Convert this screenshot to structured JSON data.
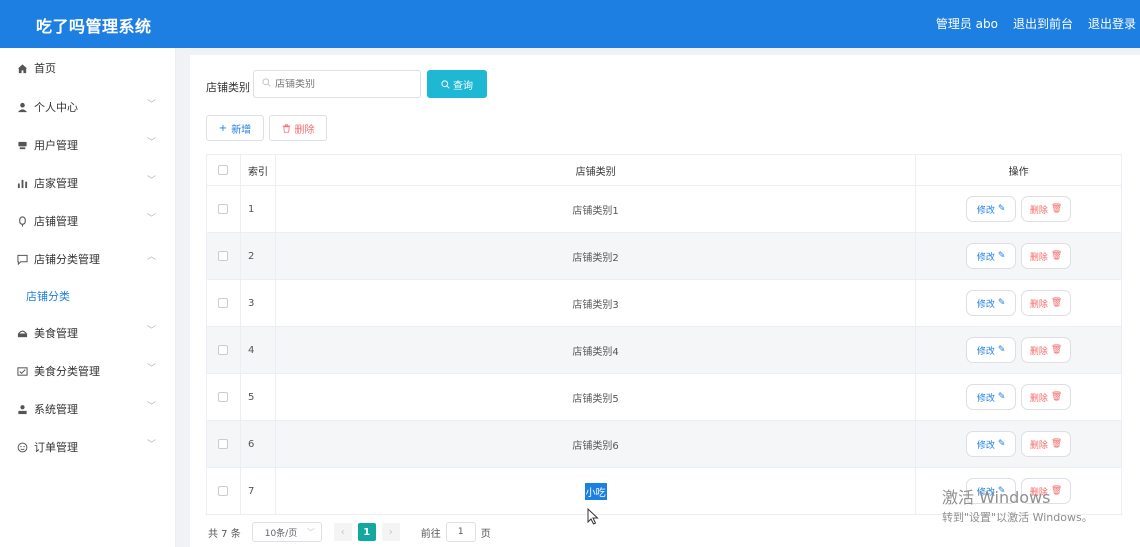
{
  "header": {
    "title": "吃了吗管理系统",
    "admin": "管理员 abo",
    "to_front": "退出到前台",
    "logout": "退出登录"
  },
  "sidebar": {
    "items": [
      {
        "label": "首页",
        "icon": "home-icon"
      },
      {
        "label": "个人中心",
        "icon": "user-icon"
      },
      {
        "label": "用户管理",
        "icon": "users-icon"
      },
      {
        "label": "店家管理",
        "icon": "bar-chart-icon"
      },
      {
        "label": "店铺管理",
        "icon": "shop-icon"
      },
      {
        "label": "店铺分类管理",
        "icon": "chat-icon"
      },
      {
        "label": "美食管理",
        "icon": "food-icon"
      },
      {
        "label": "美食分类管理",
        "icon": "tag-icon"
      },
      {
        "label": "系统管理",
        "icon": "settings-user-icon"
      },
      {
        "label": "订单管理",
        "icon": "order-icon"
      }
    ],
    "active_sub": "店铺分类"
  },
  "search": {
    "label": "店铺类别",
    "placeholder": "店铺类别",
    "query_button": "查询"
  },
  "toolbar": {
    "add": "新增",
    "delete": "删除"
  },
  "table": {
    "columns": [
      "索引",
      "店铺类别",
      "操作"
    ],
    "rows": [
      {
        "index": "1",
        "name": "店铺类别1"
      },
      {
        "index": "2",
        "name": "店铺类别2"
      },
      {
        "index": "3",
        "name": "店铺类别3"
      },
      {
        "index": "4",
        "name": "店铺类别4"
      },
      {
        "index": "5",
        "name": "店铺类别5"
      },
      {
        "index": "6",
        "name": "店铺类别6"
      },
      {
        "index": "7",
        "name": "小吃"
      }
    ],
    "edit_label": "修改",
    "delete_label": "删除"
  },
  "pagination": {
    "total": "共 7 条",
    "page_size": "10条/页",
    "current": "1",
    "goto_label": "前往",
    "goto_value": "1",
    "page_unit": "页"
  },
  "watermark": {
    "line1": "激活 Windows",
    "line2": "转到\"设置\"以激活 Windows。"
  },
  "colors": {
    "primary": "#1e7fe3",
    "query": "#1fb8d4",
    "danger": "#f56c6c",
    "page_active": "#13a89e"
  }
}
